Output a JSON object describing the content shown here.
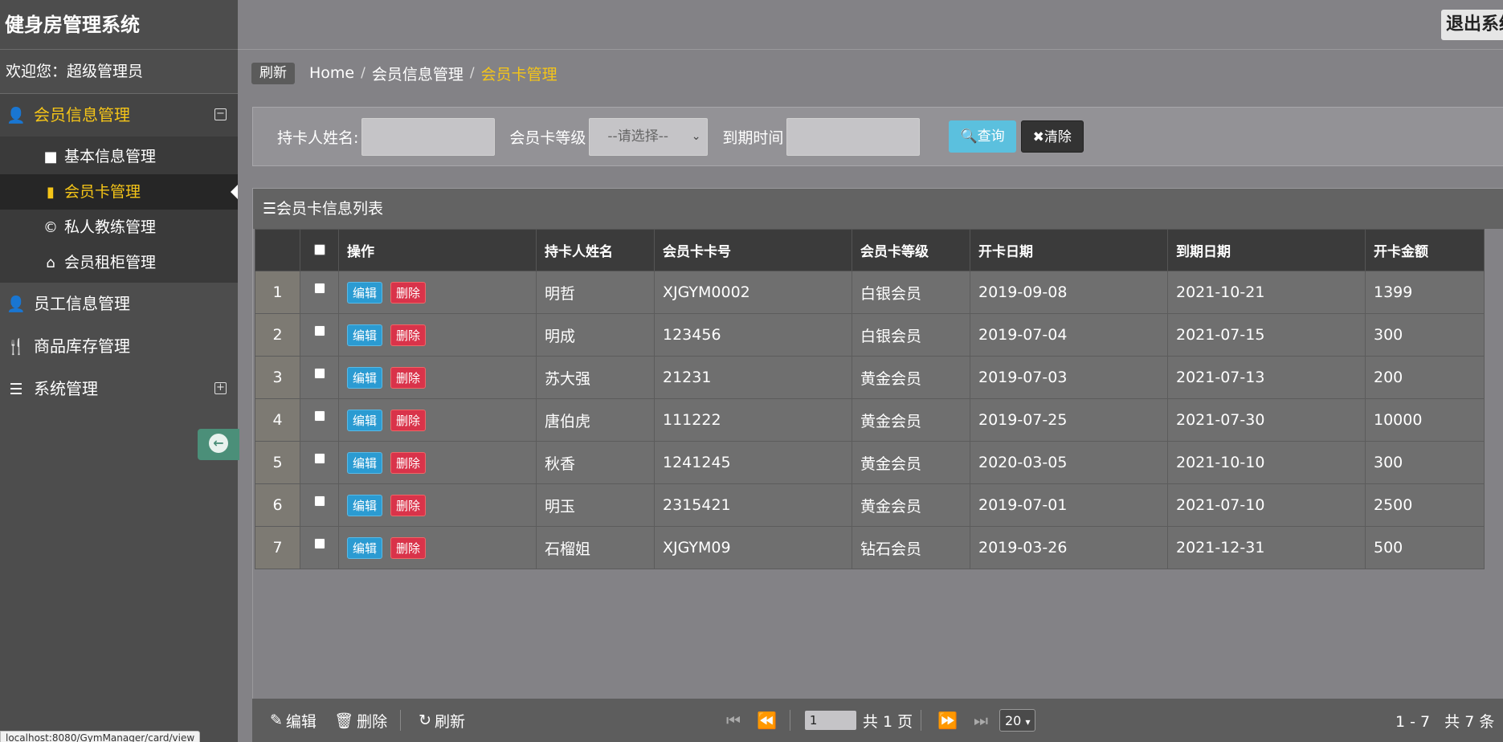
{
  "app": {
    "title": "健身房管理系统",
    "logout_label": "退出系统"
  },
  "sidebar": {
    "welcome": "欢迎您：超级管理员",
    "groups": [
      {
        "label": "会员信息管理",
        "icon": "user-icon"
      },
      {
        "label": "员工信息管理",
        "icon": "user-icon"
      },
      {
        "label": "商品库存管理",
        "icon": "cutlery-icon"
      },
      {
        "label": "系统管理",
        "icon": "list-icon"
      }
    ],
    "subitems": [
      {
        "label": "基本信息管理",
        "icon": "folder-icon"
      },
      {
        "label": "会员卡管理",
        "icon": "book-icon"
      },
      {
        "label": "私人教练管理",
        "icon": "copyright-icon"
      },
      {
        "label": "会员租柜管理",
        "icon": "home-icon"
      }
    ]
  },
  "status_url": "localhost:8080/GymManager/card/view",
  "breadcrumb": {
    "refresh": "刷新",
    "home": "Home",
    "parent": "会员信息管理",
    "current": "会员卡管理"
  },
  "search": {
    "name_label": "持卡人姓名:",
    "level_label": "会员卡等级",
    "level_placeholder": "--请选择--",
    "expiry_label": "到期时间",
    "query_label": "查询",
    "clear_label": "清除"
  },
  "list": {
    "title": "会员卡信息列表",
    "columns": [
      "操作",
      "持卡人姓名",
      "会员卡卡号",
      "会员卡等级",
      "开卡日期",
      "到期日期",
      "开卡金额"
    ],
    "edit_label": "编辑",
    "delete_label": "删除",
    "rows": [
      {
        "num": "1",
        "name": "明哲",
        "card_no": "XJGYM0002",
        "level": "白银会员",
        "open_date": "2019-09-08",
        "expire_date": "2021-10-21",
        "amount": "1399"
      },
      {
        "num": "2",
        "name": "明成",
        "card_no": "123456",
        "level": "白银会员",
        "open_date": "2019-07-04",
        "expire_date": "2021-07-15",
        "amount": "300"
      },
      {
        "num": "3",
        "name": "苏大强",
        "card_no": "21231",
        "level": "黄金会员",
        "open_date": "2019-07-03",
        "expire_date": "2021-07-13",
        "amount": "200"
      },
      {
        "num": "4",
        "name": "唐伯虎",
        "card_no": "111222",
        "level": "黄金会员",
        "open_date": "2019-07-25",
        "expire_date": "2021-07-30",
        "amount": "10000"
      },
      {
        "num": "5",
        "name": "秋香",
        "card_no": "1241245",
        "level": "黄金会员",
        "open_date": "2020-03-05",
        "expire_date": "2021-10-10",
        "amount": "300"
      },
      {
        "num": "6",
        "name": "明玉",
        "card_no": "2315421",
        "level": "黄金会员",
        "open_date": "2019-07-01",
        "expire_date": "2021-07-10",
        "amount": "2500"
      },
      {
        "num": "7",
        "name": "石榴姐",
        "card_no": "XJGYM09",
        "level": "钻石会员",
        "open_date": "2019-03-26",
        "expire_date": "2021-12-31",
        "amount": "500"
      }
    ]
  },
  "pager": {
    "edit": "编辑",
    "delete": "删除",
    "refresh": "刷新",
    "page_value": "1",
    "total_pages": "共 1 页",
    "page_size": "20",
    "range": "1 - 7",
    "total_records": "共 7 条"
  }
}
